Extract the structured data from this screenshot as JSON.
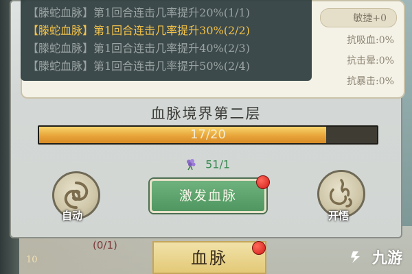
{
  "tooltip": {
    "lines": [
      {
        "text": "【滕蛇血脉】第1回合连击几率提升20%(1/1)",
        "active": false
      },
      {
        "text": "【滕蛇血脉】第1回合连击几率提升30%(2/2)",
        "active": true
      },
      {
        "text": "【滕蛇血脉】第1回合连击几率提升40%(2/3)",
        "active": false
      },
      {
        "text": "【滕蛇血脉】第1回合连击几率提升50%(2/4)",
        "active": false
      }
    ]
  },
  "stats": {
    "top_right": "敏捷+0",
    "right_2": "抗吸血:0%",
    "right_3": "抗击晕:0%",
    "right_4": "抗暴击:0%"
  },
  "realm": {
    "title": "血脉境界第二层"
  },
  "progress": {
    "label": "17/20",
    "current": 17,
    "max": 20
  },
  "cost": {
    "amount": "51/1",
    "icon": "grape-flower-icon"
  },
  "buttons": {
    "auto_label": "自动",
    "activate_label": "激发血脉",
    "enlighten_label": "开悟"
  },
  "bottom": {
    "counter": "(0/1)",
    "level": "10",
    "tab_label": "血脉"
  },
  "watermark": {
    "text": "九游"
  },
  "colors": {
    "active_line": "#f2c24a",
    "progress_fill": "#e8a53a",
    "activate_button": "#5aa56b",
    "notification_dot": "#d21c18"
  }
}
